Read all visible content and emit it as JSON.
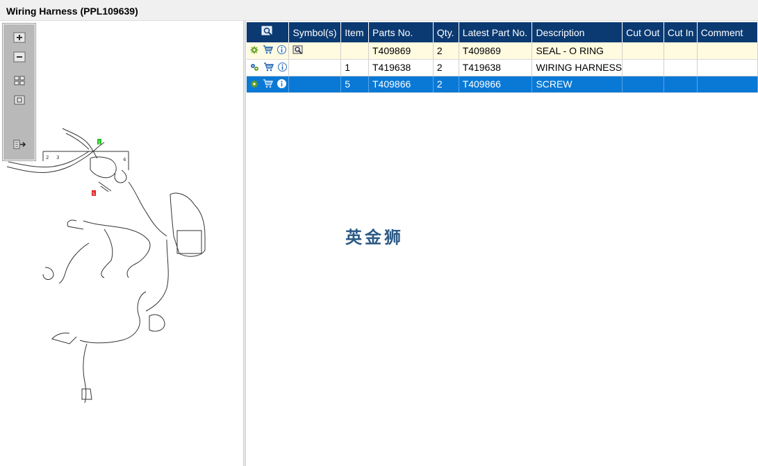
{
  "window": {
    "title": "Wiring Harness (PPL109639)"
  },
  "diagram": {
    "toolbar": [
      {
        "name": "zoom-in-icon"
      },
      {
        "name": "zoom-out-icon"
      },
      {
        "name": "fit-grid-icon"
      },
      {
        "name": "actual-size-icon"
      },
      {
        "name": "export-list-icon"
      }
    ],
    "callouts": [
      "1",
      "2",
      "3",
      "4",
      "5"
    ]
  },
  "table": {
    "columns": [
      "",
      "Symbol(s)",
      "Item",
      "Parts No.",
      "Qty.",
      "Latest Part No.",
      "Description",
      "Cut Out",
      "Cut In",
      "Comment"
    ],
    "rows": [
      {
        "item": "",
        "part_no": "T409869",
        "qty": "2",
        "latest": "T409869",
        "description": "SEAL - O RING",
        "cut_out": "",
        "cut_in": "",
        "comment": "",
        "state": "highlighted",
        "has_symbol": true
      },
      {
        "item": "1",
        "part_no": "T419638",
        "qty": "2",
        "latest": "T419638",
        "description": "WIRING HARNESS",
        "cut_out": "",
        "cut_in": "",
        "comment": "",
        "state": "normal",
        "has_symbol": false
      },
      {
        "item": "5",
        "part_no": "T409866",
        "qty": "2",
        "latest": "T409866",
        "description": "SCREW",
        "cut_out": "",
        "cut_in": "",
        "comment": "",
        "state": "selected",
        "has_symbol": false
      }
    ]
  },
  "watermark": "英金狮",
  "colors": {
    "header_bg": "#0b3a72",
    "selected_row": "#0a79d6",
    "highlight_row": "#fffbe0",
    "gear_icon": "#6aa121",
    "cart_icon": "#2a6bb5"
  }
}
